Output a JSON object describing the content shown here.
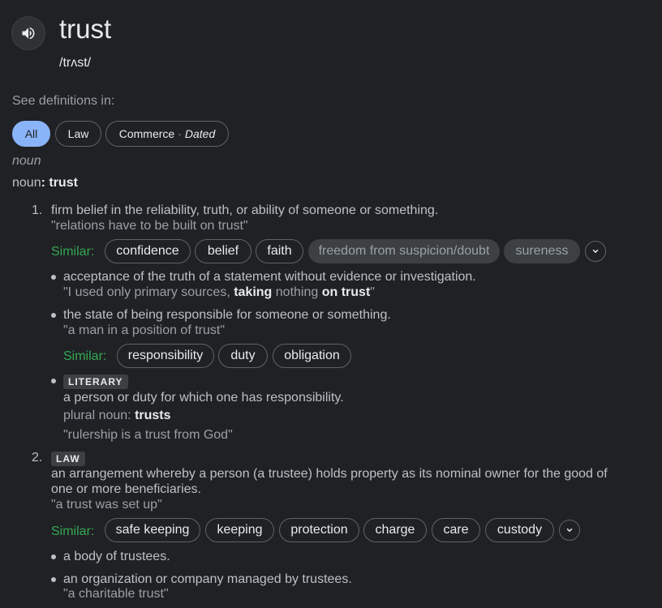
{
  "header": {
    "word": "trust",
    "phonetic": "/trʌst/",
    "speaker_icon": "speaker-icon"
  },
  "filters": {
    "label": "See definitions in:",
    "chips": [
      {
        "label": "All",
        "active": true
      },
      {
        "label": "Law"
      },
      {
        "label": "Commerce",
        "separator": "·",
        "qualifier": "Dated"
      }
    ]
  },
  "entry": {
    "part_of_speech": "noun",
    "headword_prefix": "noun",
    "headword_sep": ": ",
    "headword": "trust"
  },
  "senses": [
    {
      "number": "1.",
      "definition": "firm belief in the reliability, truth, or ability of someone or something.",
      "example": "\"relations have to be built on trust\"",
      "similar_label": "Similar:",
      "similar": [
        "confidence",
        "belief",
        "faith",
        "freedom from suspicion/doubt",
        "sureness"
      ],
      "subsenses": [
        {
          "definition": "acceptance of the truth of a statement without evidence or investigation.",
          "example_parts": [
            "\"I used only primary sources, ",
            "taking",
            " nothing ",
            "on trust",
            "\""
          ]
        },
        {
          "definition": "the state of being responsible for someone or something.",
          "example": "\"a man in a position of trust\"",
          "similar_label": "Similar:",
          "similar": [
            "responsibility",
            "duty",
            "obligation"
          ]
        },
        {
          "tag": "LITERARY",
          "definition": "a person or duty for which one has responsibility.",
          "plural_label": "plural noun: ",
          "plural": "trusts",
          "example": "\"rulership is a trust from God\""
        }
      ]
    },
    {
      "number": "2.",
      "tag": "LAW",
      "definition_line1": "an arrangement whereby a person (a trustee) holds property as its nominal owner for the good of",
      "definition_line2": "one or more beneficiaries.",
      "example": "\"a trust was set up\"",
      "similar_label": "Similar:",
      "similar": [
        "safe keeping",
        "keeping",
        "protection",
        "charge",
        "care",
        "custody"
      ],
      "subsenses": [
        {
          "definition": "a body of trustees."
        },
        {
          "definition": "an organization or company managed by trustees.",
          "example": "\"a charitable trust\""
        }
      ]
    }
  ],
  "colors": {
    "background": "#202124",
    "text": "#bdc1c6",
    "similar_label": "#34a853",
    "active_chip": "#8ab4f8"
  }
}
